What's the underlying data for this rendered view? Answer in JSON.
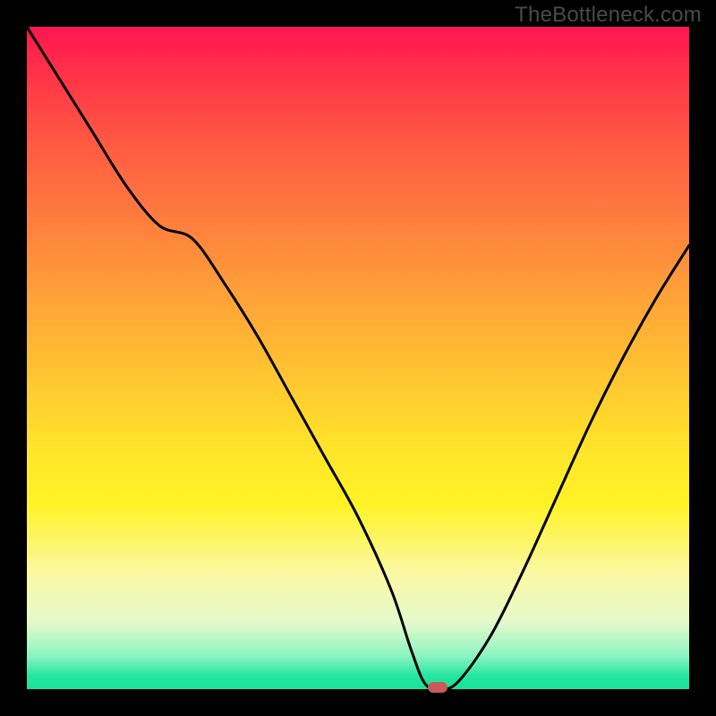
{
  "watermark": "TheBottleneck.com",
  "chart_data": {
    "type": "line",
    "title": "",
    "xlabel": "",
    "ylabel": "",
    "xlim": [
      0,
      100
    ],
    "ylim": [
      0,
      100
    ],
    "x": [
      0,
      5,
      10,
      15,
      20,
      25,
      30,
      35,
      40,
      45,
      50,
      55,
      58,
      60,
      62,
      65,
      70,
      75,
      80,
      85,
      90,
      95,
      100
    ],
    "y": [
      100,
      92,
      84,
      76,
      70,
      68,
      61,
      53,
      44,
      35,
      26,
      15,
      6,
      1,
      0,
      1,
      8,
      18,
      29,
      40,
      50,
      59,
      67
    ],
    "marker": {
      "x": 62,
      "y": 0
    },
    "annotations": []
  },
  "colors": {
    "background_top": "#ff1550",
    "background_mid": "#ffe52a",
    "background_bottom": "#17e29b",
    "curve": "#000000",
    "marker": "#c95a5a",
    "frame": "#000000"
  }
}
